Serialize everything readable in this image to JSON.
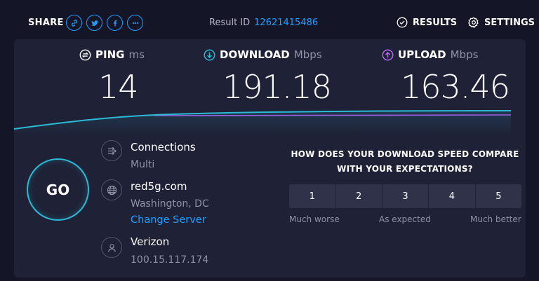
{
  "topbar": {
    "share_label": "SHARE",
    "share_icons": [
      "link-icon",
      "twitter-icon",
      "facebook-icon",
      "more-icon"
    ],
    "result_id_label": "Result ID",
    "result_id_value": "12621415486",
    "results_label": "RESULTS",
    "settings_label": "SETTINGS"
  },
  "metrics": {
    "ping": {
      "label": "PING",
      "unit": "ms",
      "value": "14",
      "icon": "ping-icon",
      "color": "#ffffff"
    },
    "download": {
      "label": "DOWNLOAD",
      "unit": "Mbps",
      "value": "191.18",
      "icon": "download-arrow-icon",
      "color": "#2bbad6"
    },
    "upload": {
      "label": "UPLOAD",
      "unit": "Mbps",
      "value": "163.46",
      "icon": "upload-arrow-icon",
      "color": "#b46cf0"
    }
  },
  "graph_colors": {
    "download": "#2bbad6",
    "upload": "#9b5fe0"
  },
  "go_label": "GO",
  "connections": {
    "title": "Connections",
    "value": "Multi",
    "icon": "connections-icon"
  },
  "server": {
    "host": "red5g.com",
    "location": "Washington, DC",
    "change_label": "Change Server",
    "icon": "globe-icon"
  },
  "isp": {
    "name": "Verizon",
    "ip": "100.15.117.174",
    "icon": "user-icon"
  },
  "survey": {
    "question_line1": "HOW DOES YOUR DOWNLOAD SPEED COMPARE",
    "question_line2": "WITH YOUR EXPECTATIONS?",
    "options": [
      "1",
      "2",
      "3",
      "4",
      "5"
    ],
    "low_label": "Much worse",
    "mid_label": "As expected",
    "high_label": "Much better"
  }
}
